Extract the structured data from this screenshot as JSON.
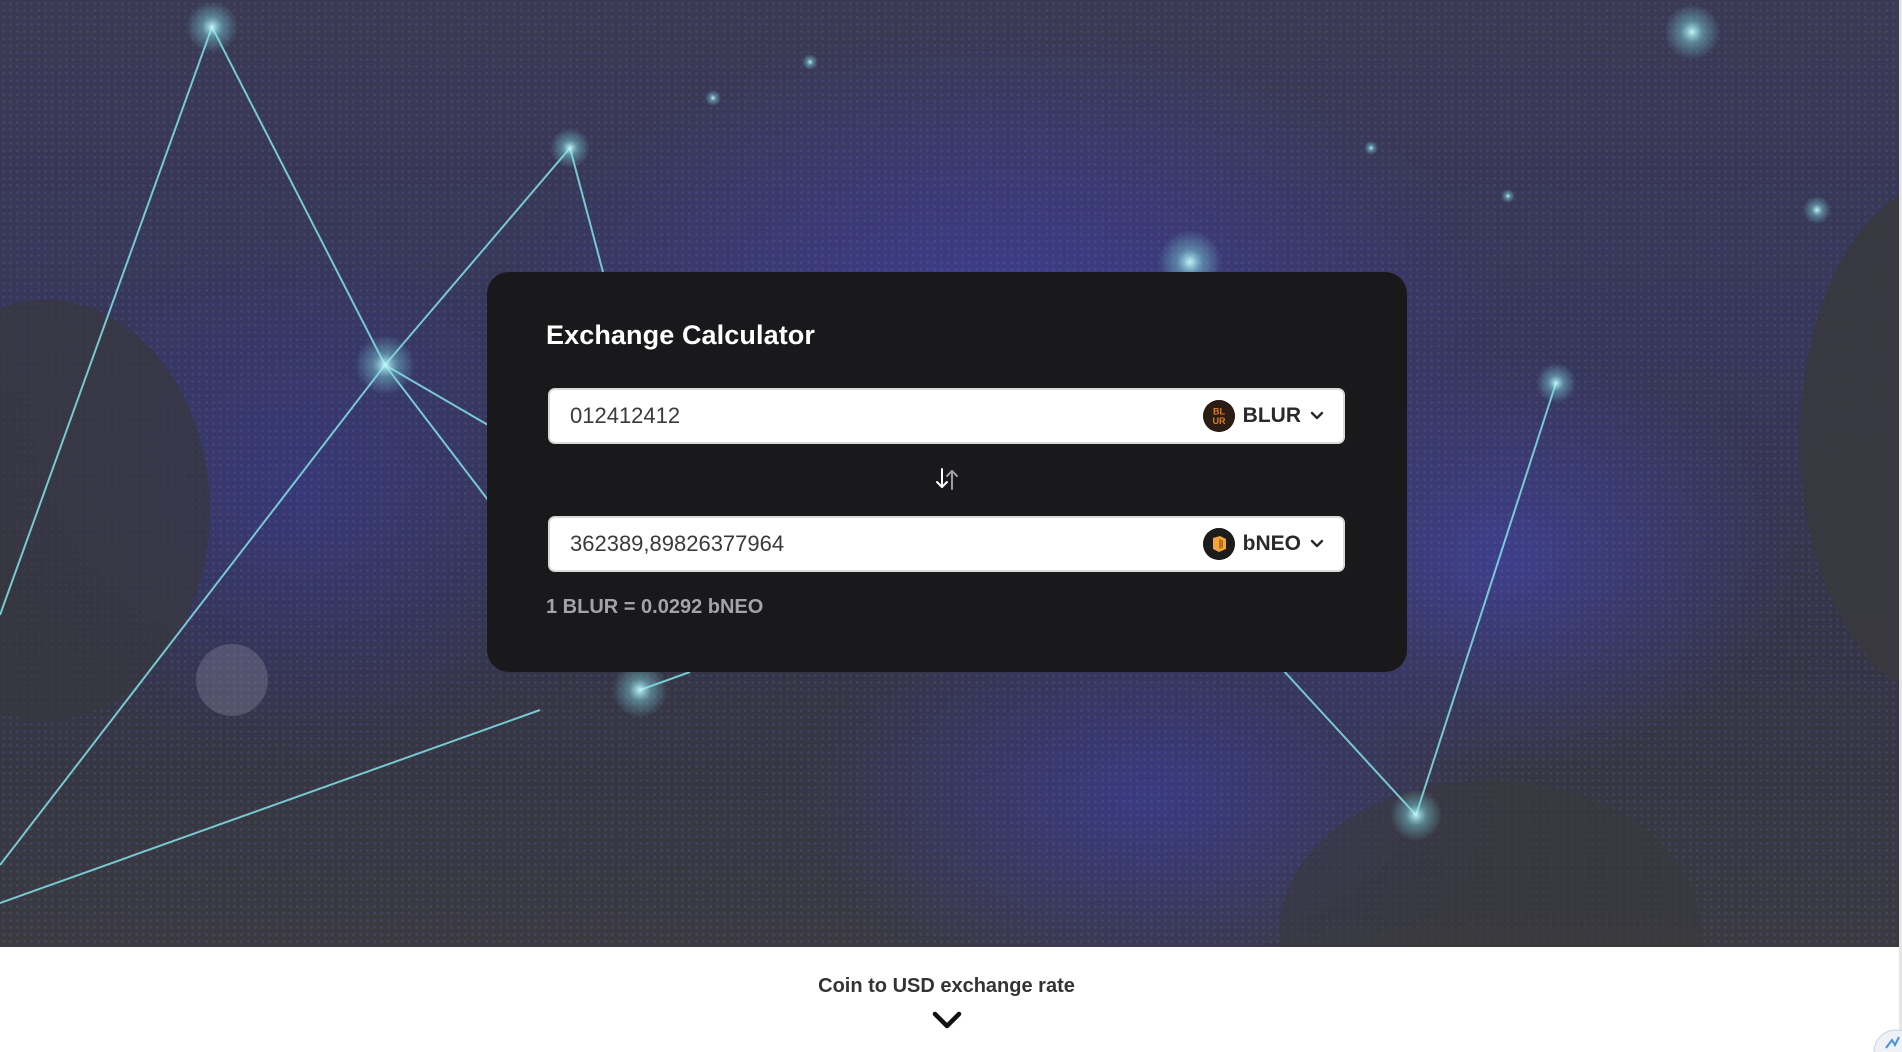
{
  "calculator": {
    "title": "Exchange Calculator",
    "from": {
      "amount": "012412412",
      "coin": "BLUR",
      "icon": "blur-coin-icon"
    },
    "to": {
      "amount": "362389,89826377964",
      "coin": "bNEO",
      "icon": "bneo-coin-icon"
    },
    "swap_icon": "swap-arrows-icon",
    "rate_text": "1 BLUR = 0.0292 bNEO"
  },
  "footer": {
    "title": "Coin to USD exchange rate",
    "toggle_icon": "chevron-down-icon"
  },
  "colors": {
    "card_bg": "#19191c",
    "hero_bg": "#37375a",
    "accent_line": "#7fd8df",
    "rate_text": "#a3a3a8"
  }
}
